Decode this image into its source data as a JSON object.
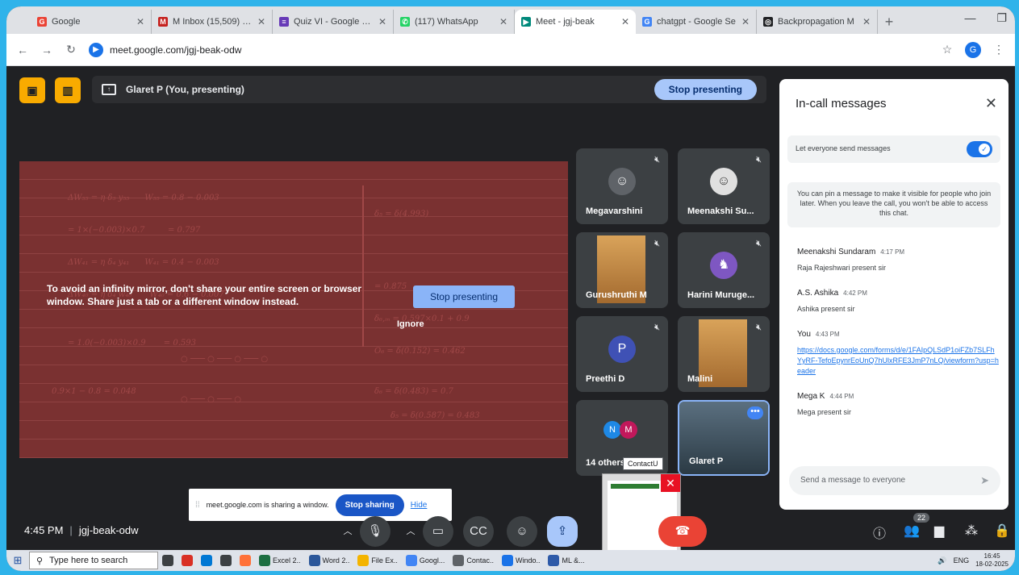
{
  "browser": {
    "tabs": [
      {
        "label": "Google",
        "icon": "google-icon",
        "color": "#ea4335",
        "glyph": "G"
      },
      {
        "label": "M Inbox (15,509) - gla",
        "icon": "gmail-icon",
        "color": "#c5221f",
        "glyph": "M"
      },
      {
        "label": "Quiz VI - Google For",
        "icon": "forms-icon",
        "color": "#673ab7",
        "glyph": "≡"
      },
      {
        "label": "(117) WhatsApp",
        "icon": "whatsapp-icon",
        "color": "#25d366",
        "glyph": "✆"
      },
      {
        "label": "Meet - jgj-beak",
        "icon": "meet-icon",
        "color": "#00897b",
        "glyph": "▶",
        "active": true
      },
      {
        "label": "chatgpt - Google Se",
        "icon": "google-icon",
        "color": "#4285f4",
        "glyph": "G"
      },
      {
        "label": "Backpropagation M",
        "icon": "chatgpt-icon",
        "color": "#202124",
        "glyph": "◎"
      }
    ],
    "url": "meet.google.com/jgj-beak-odw",
    "profile_initial": "G"
  },
  "meet": {
    "presenting_label": "Glaret P (You, presenting)",
    "stop_presenting": "Stop presenting",
    "mirror_warning": "To avoid an infinity mirror, don't share your entire screen or browser window. Share just a tab or a different window instead.",
    "stop_presenting_center": "Stop presenting",
    "ignore": "Ignore",
    "time": "4:45 PM",
    "meeting_code": "jgj-beak-odw",
    "participant_count": "22"
  },
  "participants": [
    {
      "name": "Megavarshini",
      "muted": true,
      "avatar_color": "#5f6368",
      "glyph": "☺"
    },
    {
      "name": "Meenakshi Su...",
      "muted": true,
      "avatar_color": "#e0e0e0",
      "glyph": "☺"
    },
    {
      "name": "Gurushruthi M",
      "muted": true,
      "video": true
    },
    {
      "name": "Harini Muruge...",
      "muted": true,
      "avatar_color": "#7e57c2",
      "glyph": "♞"
    },
    {
      "name": "Preethi D",
      "muted": true,
      "avatar_color": "#3f51b5",
      "initial": "P"
    },
    {
      "name": "Malini",
      "muted": true,
      "video": true
    },
    {
      "name": "14 others",
      "others": [
        "N",
        "M"
      ]
    },
    {
      "name": "Glaret P",
      "self": true
    }
  ],
  "chat": {
    "title": "In-call messages",
    "toggle_label": "Let everyone send messages",
    "toggle_on": true,
    "pin_info": "You can pin a message to make it visible for people who join later. When you leave the call, you won't be able to access this chat.",
    "messages": [
      {
        "sender": "Meenakshi Sundaram",
        "time": "4:17 PM",
        "text": "Raja Rajeshwari present sir"
      },
      {
        "sender": "A.S. Ashika",
        "time": "4:42 PM",
        "text": "Ashika present sir"
      },
      {
        "sender": "You",
        "time": "4:43 PM",
        "link": "https://docs.google.com/forms/d/e/1FAIpQLSdP1oiFZb7SLFhYyRF-TefoEpynrEoUnQ7hUlxRFE3JmP7nLQ/viewform?usp=header"
      },
      {
        "sender": "Mega K",
        "time": "4:44 PM",
        "text": "Mega present sir"
      }
    ],
    "input_placeholder": "Send a message to everyone"
  },
  "share_banner": {
    "text": "meet.google.com is sharing a window.",
    "stop": "Stop sharing",
    "hide": "Hide"
  },
  "contact_tip": "ContactU",
  "taskbar": {
    "search_placeholder": "Type here to search",
    "items": [
      "Excel 2..",
      "Word 2..",
      "File Ex..",
      "Googl...",
      "Contac..",
      "Windo..",
      "ML &..."
    ],
    "lang": "ENG",
    "time": "16:45",
    "date": "18-02-2025"
  }
}
